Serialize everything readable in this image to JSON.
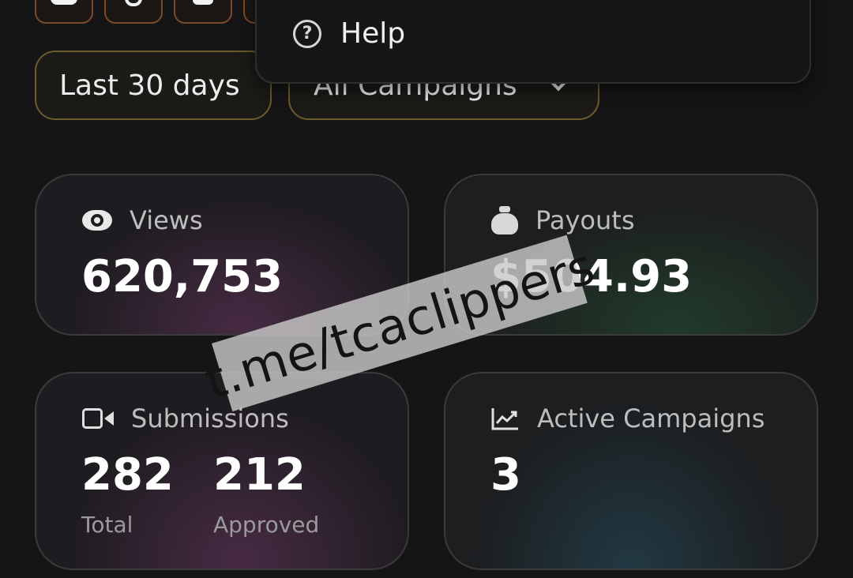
{
  "filters": {
    "range_label": "Last 30 days",
    "campaign_label": "All Campaigns"
  },
  "menu": {
    "help_label": "Help",
    "help_icon": "help-circle-icon"
  },
  "stats": {
    "views": {
      "label": "Views",
      "value": "620,753",
      "icon": "eye-icon"
    },
    "payouts": {
      "label": "Payouts",
      "value": "$504.93",
      "icon": "money-bag-icon"
    },
    "submissions": {
      "label": "Submissions",
      "icon": "video-camera-icon",
      "total_value": "282",
      "total_label": "Total",
      "approved_value": "212",
      "approved_label": "Approved"
    },
    "active_campaigns": {
      "label": "Active Campaigns",
      "value": "3",
      "icon": "trending-up-icon"
    }
  },
  "watermark": {
    "text": "t.me/tcaclippers"
  },
  "colors": {
    "background": "#151515",
    "pill_border": "#6b5a2c",
    "platform_border": "#7a4a2c",
    "card_border": "#3a3a3a"
  }
}
